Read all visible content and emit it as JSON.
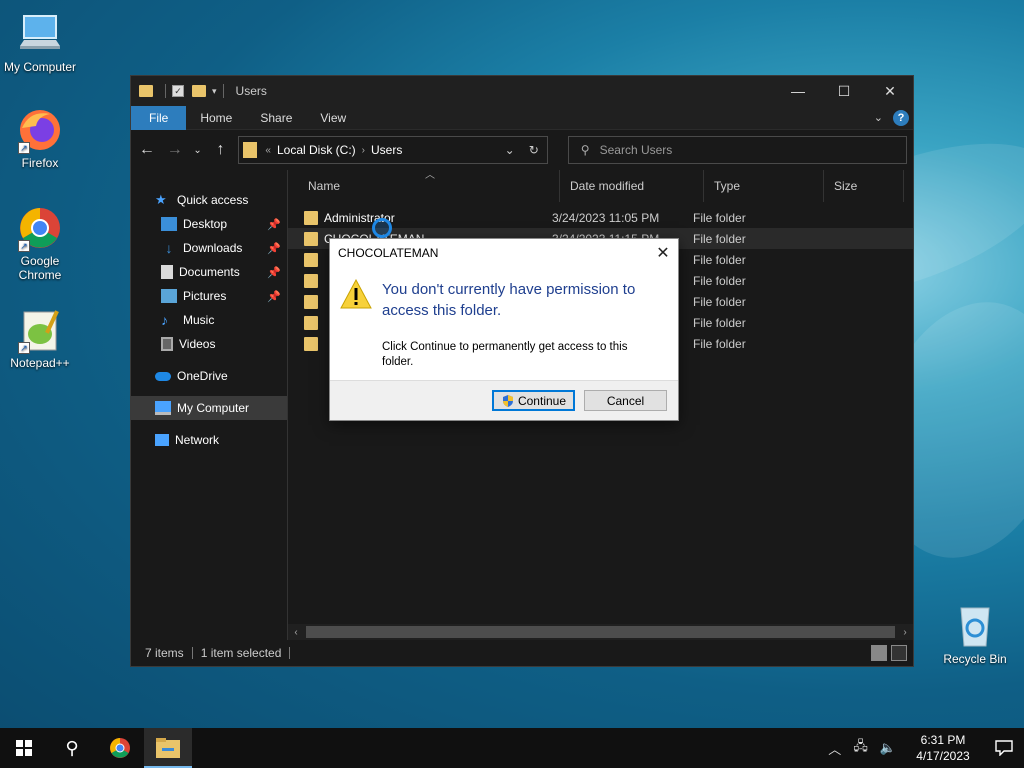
{
  "desktop": {
    "icons": [
      {
        "label": "My Computer"
      },
      {
        "label": "Firefox"
      },
      {
        "label": "Google Chrome"
      },
      {
        "label": "Notepad++"
      },
      {
        "label": "Recycle Bin"
      }
    ]
  },
  "explorer": {
    "title": "Users",
    "ribbon_tabs": [
      "File",
      "Home",
      "Share",
      "View"
    ],
    "address": {
      "crumbs": [
        "Local Disk (C:)",
        "Users"
      ]
    },
    "search_placeholder": "Search Users",
    "nav": {
      "quick_access": "Quick access",
      "items": [
        "Desktop",
        "Downloads",
        "Documents",
        "Pictures",
        "Music",
        "Videos"
      ],
      "onedrive": "OneDrive",
      "my_computer": "My Computer",
      "network": "Network"
    },
    "columns": [
      "Name",
      "Date modified",
      "Type",
      "Size"
    ],
    "rows": [
      {
        "name": "Administrator",
        "date": "3/24/2023 11:05 PM",
        "type": "File folder"
      },
      {
        "name": "CHOCOLATEMAN",
        "date": "3/24/2023 11:15 PM",
        "type": "File folder"
      },
      {
        "name": "",
        "date": "",
        "type": "File folder"
      },
      {
        "name": "",
        "date": "",
        "type": "File folder"
      },
      {
        "name": "",
        "date": "",
        "type": "File folder"
      },
      {
        "name": "",
        "date": "",
        "type": "File folder"
      },
      {
        "name": "",
        "date": "",
        "type": "File folder"
      }
    ],
    "status": {
      "count": "7 items",
      "selected": "1 item selected"
    }
  },
  "dialog": {
    "title": "CHOCOLATEMAN",
    "heading": "You don't currently have permission to access this folder.",
    "body": "Click Continue to permanently get access to this folder.",
    "continue_label": "Continue",
    "cancel_label": "Cancel"
  },
  "taskbar": {
    "time": "6:31 PM",
    "date": "4/17/2023"
  },
  "colors": {
    "accent": "#2d7dbd",
    "folder": "#e9c46a",
    "dialog_heading": "#1f3f8f"
  }
}
